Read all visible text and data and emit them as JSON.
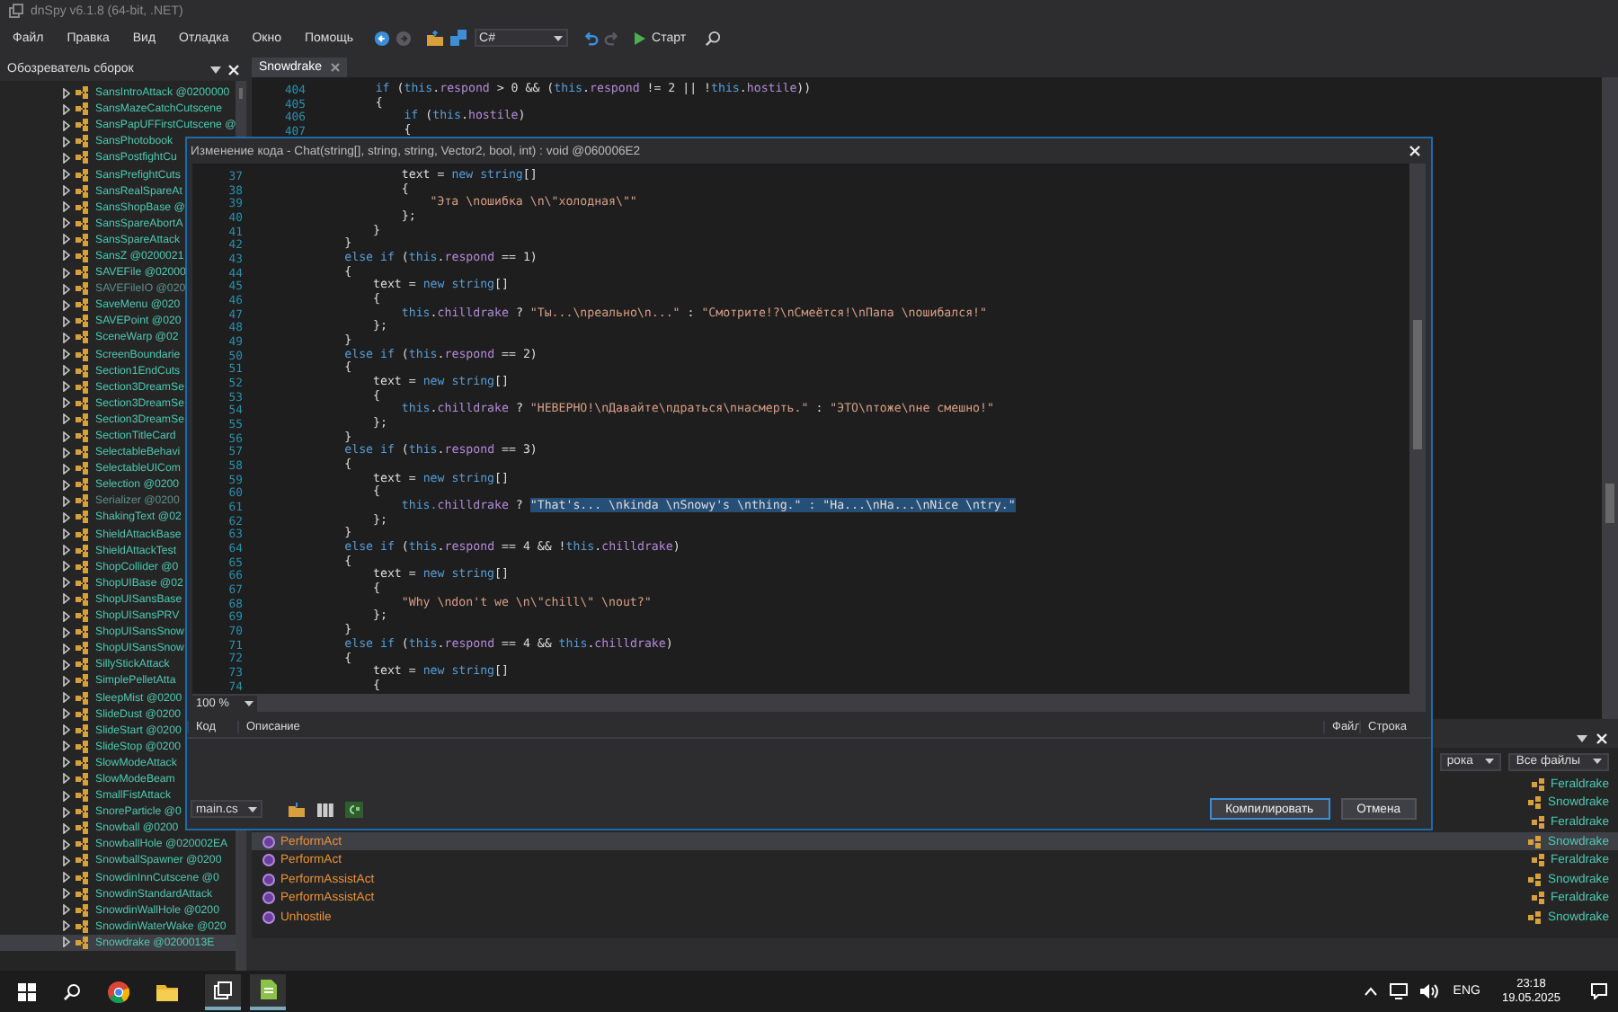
{
  "window": {
    "title": "dnSpy v6.1.8 (64-bit, .NET)"
  },
  "menu": [
    "Файл",
    "Правка",
    "Вид",
    "Отладка",
    "Окно",
    "Помощь"
  ],
  "toolbar": {
    "language": "C#",
    "start": "Старт"
  },
  "assembly_explorer": {
    "title": "Обозреватель сборок",
    "items": [
      {
        "label": "SansIntroAttack @0200000",
        "dimmed": false,
        "selected": false
      },
      {
        "label": "SansMazeCatchCutscene",
        "dimmed": false,
        "selected": false
      },
      {
        "label": "SansPapUFFirstCutscene @",
        "dimmed": false,
        "selected": false
      },
      {
        "label": "SansPhotobook",
        "dimmed": false,
        "selected": false
      },
      {
        "label": "SansPostfightCu",
        "dimmed": false,
        "selected": false
      },
      {
        "label": "SansPrefightCuts",
        "dimmed": false,
        "selected": false
      },
      {
        "label": "SansRealSpareAt",
        "dimmed": false,
        "selected": false
      },
      {
        "label": "SansShopBase @",
        "dimmed": false,
        "selected": false
      },
      {
        "label": "SansSpareAbortA",
        "dimmed": false,
        "selected": false
      },
      {
        "label": "SansSpareAttack",
        "dimmed": false,
        "selected": false
      },
      {
        "label": "SansZ @0200021",
        "dimmed": false,
        "selected": false
      },
      {
        "label": "SAVEFile @02000",
        "dimmed": false,
        "selected": false
      },
      {
        "label": "SAVEFileIO @020",
        "dimmed": true,
        "selected": false
      },
      {
        "label": "SaveMenu @020",
        "dimmed": false,
        "selected": false
      },
      {
        "label": "SAVEPoint @020",
        "dimmed": false,
        "selected": false
      },
      {
        "label": "SceneWarp @02",
        "dimmed": false,
        "selected": false
      },
      {
        "label": "ScreenBoundarie",
        "dimmed": false,
        "selected": false
      },
      {
        "label": "Section1EndCuts",
        "dimmed": false,
        "selected": false
      },
      {
        "label": "Section3DreamSe",
        "dimmed": false,
        "selected": false
      },
      {
        "label": "Section3DreamSe",
        "dimmed": false,
        "selected": false
      },
      {
        "label": "Section3DreamSe",
        "dimmed": false,
        "selected": false
      },
      {
        "label": "SectionTitleCard",
        "dimmed": false,
        "selected": false
      },
      {
        "label": "SelectableBehavi",
        "dimmed": false,
        "selected": false
      },
      {
        "label": "SelectableUICom",
        "dimmed": false,
        "selected": false
      },
      {
        "label": "Selection @0200",
        "dimmed": false,
        "selected": false
      },
      {
        "label": "Serializer @0200",
        "dimmed": true,
        "selected": false
      },
      {
        "label": "ShakingText @02",
        "dimmed": false,
        "selected": false
      },
      {
        "label": "ShieldAttackBase",
        "dimmed": false,
        "selected": false
      },
      {
        "label": "ShieldAttackTest",
        "dimmed": false,
        "selected": false
      },
      {
        "label": "ShopCollider @0",
        "dimmed": false,
        "selected": false
      },
      {
        "label": "ShopUIBase @02",
        "dimmed": false,
        "selected": false
      },
      {
        "label": "ShopUISansBase",
        "dimmed": false,
        "selected": false
      },
      {
        "label": "ShopUISansPRV",
        "dimmed": false,
        "selected": false
      },
      {
        "label": "ShopUISansSnow",
        "dimmed": false,
        "selected": false
      },
      {
        "label": "ShopUISansSnow",
        "dimmed": false,
        "selected": false
      },
      {
        "label": "SillyStickAttack",
        "dimmed": false,
        "selected": false
      },
      {
        "label": "SimplePelletAtta",
        "dimmed": false,
        "selected": false
      },
      {
        "label": "SleepMist @0200",
        "dimmed": false,
        "selected": false
      },
      {
        "label": "SlideDust @0200",
        "dimmed": false,
        "selected": false
      },
      {
        "label": "SlideStart @0200",
        "dimmed": false,
        "selected": false
      },
      {
        "label": "SlideStop @0200",
        "dimmed": false,
        "selected": false
      },
      {
        "label": "SlowModeAttack",
        "dimmed": false,
        "selected": false
      },
      {
        "label": "SlowModeBeam",
        "dimmed": false,
        "selected": false
      },
      {
        "label": "SmallFistAttack",
        "dimmed": false,
        "selected": false
      },
      {
        "label": "SnoreParticle @0",
        "dimmed": false,
        "selected": false
      },
      {
        "label": "Snowball @0200",
        "dimmed": false,
        "selected": false
      },
      {
        "label": "SnowballHole @020002EA",
        "dimmed": false,
        "selected": false
      },
      {
        "label": "SnowballSpawner @0200",
        "dimmed": false,
        "selected": false
      },
      {
        "label": "SnowdinInnCutscene @0",
        "dimmed": false,
        "selected": false
      },
      {
        "label": "SnowdinStandardAttack",
        "dimmed": false,
        "selected": false
      },
      {
        "label": "SnowdinWallHole @0200",
        "dimmed": false,
        "selected": false
      },
      {
        "label": "SnowdinWaterWake @020",
        "dimmed": false,
        "selected": false
      },
      {
        "label": "Snowdrake @0200013E",
        "dimmed": false,
        "selected": true
      }
    ]
  },
  "editor": {
    "tab": {
      "label": "Snowdrake",
      "selected": true
    },
    "lines": [
      {
        "num": "404",
        "tokens": [
          {
            "kind": "keyword",
            "text": "      if"
          },
          {
            "kind": "plain",
            "text": " ("
          },
          {
            "kind": "keyword",
            "text": "this"
          },
          {
            "kind": "plain",
            "text": "."
          },
          {
            "kind": "field",
            "text": "respond"
          },
          {
            "kind": "plain",
            "text": " > 0 && ("
          },
          {
            "kind": "keyword",
            "text": "this"
          },
          {
            "kind": "plain",
            "text": "."
          },
          {
            "kind": "field",
            "text": "respond"
          },
          {
            "kind": "plain",
            "text": " != 2 || !"
          },
          {
            "kind": "keyword",
            "text": "this"
          },
          {
            "kind": "plain",
            "text": "."
          },
          {
            "kind": "field",
            "text": "hostile"
          },
          {
            "kind": "plain",
            "text": "))"
          }
        ]
      },
      {
        "num": "405",
        "tokens": [
          {
            "kind": "plain",
            "text": "      {"
          }
        ]
      },
      {
        "num": "406",
        "tokens": [
          {
            "kind": "keyword",
            "text": "          if"
          },
          {
            "kind": "plain",
            "text": " ("
          },
          {
            "kind": "keyword",
            "text": "this"
          },
          {
            "kind": "plain",
            "text": "."
          },
          {
            "kind": "field",
            "text": "hostile"
          },
          {
            "kind": "plain",
            "text": ")"
          }
        ]
      },
      {
        "num": "407",
        "tokens": [
          {
            "kind": "plain",
            "text": "          {"
          }
        ]
      }
    ]
  },
  "edit_dialog": {
    "title": "Изменение кода - Chat(string[], string, string, Vector2, bool, int) : void @060006E2",
    "lines": [
      {
        "num": "37",
        "tokens": [
          {
            "kind": "plain",
            "text": "                    text = "
          },
          {
            "kind": "keyword",
            "text": "new string"
          },
          {
            "kind": "plain",
            "text": "[]"
          }
        ]
      },
      {
        "num": "38",
        "tokens": [
          {
            "kind": "plain",
            "text": "                    {"
          }
        ]
      },
      {
        "num": "39",
        "tokens": [
          {
            "kind": "string",
            "text": "                        \"Эта \\nошибка \\n\\\"холодная\\\"\""
          }
        ]
      },
      {
        "num": "40",
        "tokens": [
          {
            "kind": "plain",
            "text": "                    };"
          }
        ]
      },
      {
        "num": "41",
        "tokens": [
          {
            "kind": "plain",
            "text": "                }"
          }
        ]
      },
      {
        "num": "42",
        "tokens": [
          {
            "kind": "plain",
            "text": "            }"
          }
        ]
      },
      {
        "num": "43",
        "tokens": [
          {
            "kind": "keyword",
            "text": "            else if"
          },
          {
            "kind": "plain",
            "text": " ("
          },
          {
            "kind": "keyword",
            "text": "this"
          },
          {
            "kind": "plain",
            "text": "."
          },
          {
            "kind": "field",
            "text": "respond"
          },
          {
            "kind": "plain",
            "text": " == 1)"
          }
        ]
      },
      {
        "num": "44",
        "tokens": [
          {
            "kind": "plain",
            "text": "            {"
          }
        ]
      },
      {
        "num": "45",
        "tokens": [
          {
            "kind": "plain",
            "text": "                text = "
          },
          {
            "kind": "keyword",
            "text": "new string"
          },
          {
            "kind": "plain",
            "text": "[]"
          }
        ]
      },
      {
        "num": "46",
        "tokens": [
          {
            "kind": "plain",
            "text": "                {"
          }
        ]
      },
      {
        "num": "47",
        "tokens": [
          {
            "kind": "keyword",
            "text": "                    this"
          },
          {
            "kind": "plain",
            "text": "."
          },
          {
            "kind": "field",
            "text": "chilldrake"
          },
          {
            "kind": "plain",
            "text": " ? "
          },
          {
            "kind": "string",
            "text": "\"Ты...\\nреально\\n...\""
          },
          {
            "kind": "plain",
            "text": " : "
          },
          {
            "kind": "string",
            "text": "\"Смотрите!?\\nСмеётся!\\nПапа \\nошибался!\""
          }
        ]
      },
      {
        "num": "48",
        "tokens": [
          {
            "kind": "plain",
            "text": "                };"
          }
        ]
      },
      {
        "num": "49",
        "tokens": [
          {
            "kind": "plain",
            "text": "            }"
          }
        ]
      },
      {
        "num": "50",
        "tokens": [
          {
            "kind": "keyword",
            "text": "            else if"
          },
          {
            "kind": "plain",
            "text": " ("
          },
          {
            "kind": "keyword",
            "text": "this"
          },
          {
            "kind": "plain",
            "text": "."
          },
          {
            "kind": "field",
            "text": "respond"
          },
          {
            "kind": "plain",
            "text": " == 2)"
          }
        ]
      },
      {
        "num": "51",
        "tokens": [
          {
            "kind": "plain",
            "text": "            {"
          }
        ]
      },
      {
        "num": "52",
        "tokens": [
          {
            "kind": "plain",
            "text": "                text = "
          },
          {
            "kind": "keyword",
            "text": "new string"
          },
          {
            "kind": "plain",
            "text": "[]"
          }
        ]
      },
      {
        "num": "53",
        "tokens": [
          {
            "kind": "plain",
            "text": "                {"
          }
        ]
      },
      {
        "num": "54",
        "tokens": [
          {
            "kind": "keyword",
            "text": "                    this"
          },
          {
            "kind": "plain",
            "text": "."
          },
          {
            "kind": "field",
            "text": "chilldrake"
          },
          {
            "kind": "plain",
            "text": " ? "
          },
          {
            "kind": "string",
            "text": "\"НЕВЕРНО!\\nДавайте\\nдраться\\nнасмерть.\""
          },
          {
            "kind": "plain",
            "text": " : "
          },
          {
            "kind": "string",
            "text": "\"ЭТО\\nтоже\\nне смешно!\""
          }
        ]
      },
      {
        "num": "55",
        "tokens": [
          {
            "kind": "plain",
            "text": "                };"
          }
        ]
      },
      {
        "num": "56",
        "tokens": [
          {
            "kind": "plain",
            "text": "            }"
          }
        ]
      },
      {
        "num": "57",
        "tokens": [
          {
            "kind": "keyword",
            "text": "            else if"
          },
          {
            "kind": "plain",
            "text": " ("
          },
          {
            "kind": "keyword",
            "text": "this"
          },
          {
            "kind": "plain",
            "text": "."
          },
          {
            "kind": "field",
            "text": "respond"
          },
          {
            "kind": "plain",
            "text": " == 3)"
          }
        ]
      },
      {
        "num": "58",
        "tokens": [
          {
            "kind": "plain",
            "text": "            {"
          }
        ]
      },
      {
        "num": "59",
        "tokens": [
          {
            "kind": "plain",
            "text": "                text = "
          },
          {
            "kind": "keyword",
            "text": "new string"
          },
          {
            "kind": "plain",
            "text": "[]"
          }
        ]
      },
      {
        "num": "60",
        "tokens": [
          {
            "kind": "plain",
            "text": "                {"
          }
        ]
      },
      {
        "num": "61",
        "tokens": [
          {
            "kind": "keyword",
            "text": "                    this."
          },
          {
            "kind": "field",
            "text": "chilldrake"
          },
          {
            "kind": "plain",
            "text": " ? "
          },
          {
            "kind": "selection",
            "text": "\"That's... \\nkinda \\nSnowy's \\nthing.\" : \"Ha...\\nHa...\\nNice \\ntry.\""
          }
        ]
      },
      {
        "num": "62",
        "tokens": [
          {
            "kind": "plain",
            "text": "                };"
          }
        ]
      },
      {
        "num": "63",
        "tokens": [
          {
            "kind": "plain",
            "text": "            }"
          }
        ]
      },
      {
        "num": "64",
        "tokens": [
          {
            "kind": "keyword",
            "text": "            else if"
          },
          {
            "kind": "plain",
            "text": " ("
          },
          {
            "kind": "keyword",
            "text": "this"
          },
          {
            "kind": "plain",
            "text": "."
          },
          {
            "kind": "field",
            "text": "respond"
          },
          {
            "kind": "plain",
            "text": " == 4 && !"
          },
          {
            "kind": "keyword",
            "text": "this"
          },
          {
            "kind": "plain",
            "text": "."
          },
          {
            "kind": "field",
            "text": "chilldrake"
          },
          {
            "kind": "plain",
            "text": ")"
          }
        ]
      },
      {
        "num": "65",
        "tokens": [
          {
            "kind": "plain",
            "text": "            {"
          }
        ]
      },
      {
        "num": "66",
        "tokens": [
          {
            "kind": "plain",
            "text": "                text = "
          },
          {
            "kind": "keyword",
            "text": "new string"
          },
          {
            "kind": "plain",
            "text": "[]"
          }
        ]
      },
      {
        "num": "67",
        "tokens": [
          {
            "kind": "plain",
            "text": "                {"
          }
        ]
      },
      {
        "num": "68",
        "tokens": [
          {
            "kind": "string",
            "text": "                    \"Why \\ndon't we \\n\\\"chill\\\" \\nout?\""
          }
        ]
      },
      {
        "num": "69",
        "tokens": [
          {
            "kind": "plain",
            "text": "                };"
          }
        ]
      },
      {
        "num": "70",
        "tokens": [
          {
            "kind": "plain",
            "text": "            }"
          }
        ]
      },
      {
        "num": "71",
        "tokens": [
          {
            "kind": "keyword",
            "text": "            else if"
          },
          {
            "kind": "plain",
            "text": " ("
          },
          {
            "kind": "keyword",
            "text": "this"
          },
          {
            "kind": "plain",
            "text": "."
          },
          {
            "kind": "field",
            "text": "respond"
          },
          {
            "kind": "plain",
            "text": " == 4 && "
          },
          {
            "kind": "keyword",
            "text": "this"
          },
          {
            "kind": "plain",
            "text": "."
          },
          {
            "kind": "field",
            "text": "chilldrake"
          },
          {
            "kind": "plain",
            "text": ")"
          }
        ]
      },
      {
        "num": "72",
        "tokens": [
          {
            "kind": "plain",
            "text": "            {"
          }
        ]
      },
      {
        "num": "73",
        "tokens": [
          {
            "kind": "plain",
            "text": "                text = "
          },
          {
            "kind": "keyword",
            "text": "new string"
          },
          {
            "kind": "plain",
            "text": "[]"
          }
        ]
      },
      {
        "num": "74",
        "tokens": [
          {
            "kind": "plain",
            "text": "                {"
          }
        ]
      }
    ],
    "zoom": "100 %",
    "error_columns": [
      "Код",
      "Описание",
      "Файл",
      "Строка"
    ],
    "file": "main.cs",
    "buttons": [
      {
        "label": "Компилировать",
        "kind": "primary"
      },
      {
        "label": "Отмена",
        "kind": "normal"
      }
    ]
  },
  "analyzer": {
    "filters": [
      "рока",
      "Все файлы"
    ],
    "rows": [
      {
        "type": "Feraldrake",
        "selected": false
      },
      {
        "type": "Snowdrake",
        "selected": false
      },
      {
        "type": "Feraldrake",
        "selected": false
      },
      {
        "member": "PerformAct",
        "type": "Snowdrake",
        "selected": true
      },
      {
        "member": "PerformAct",
        "type": "Feraldrake",
        "selected": false
      },
      {
        "member": "PerformAssistAct",
        "type": "Snowdrake",
        "selected": false
      },
      {
        "member": "PerformAssistAct",
        "type": "Feraldrake",
        "selected": false
      },
      {
        "member": "Unhostile",
        "type": "Snowdrake",
        "selected": false
      }
    ]
  },
  "taskbar": {
    "language": "ENG",
    "time": "23:18",
    "date": "19.05.2025"
  }
}
